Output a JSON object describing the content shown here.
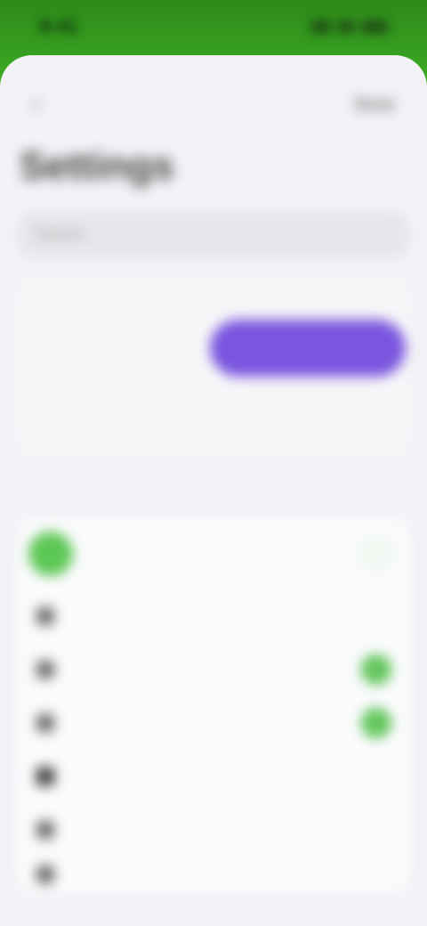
{
  "status_bar": {
    "time": "9:41"
  },
  "nav": {
    "back_glyph": "‹",
    "done_label": "Done"
  },
  "page": {
    "title": "Settings",
    "search_placeholder": "Search"
  },
  "mode_card": {
    "caption": "",
    "left_option": "",
    "right_option": "",
    "description": ""
  },
  "section": {
    "header": ""
  },
  "rows": [
    {
      "label": "",
      "icon": "app-icon",
      "check": "ring"
    },
    {
      "label": "",
      "icon": "dot-icon",
      "check": "off"
    },
    {
      "label": "",
      "icon": "dot-icon",
      "check": "on"
    },
    {
      "label": "",
      "icon": "dot-icon",
      "check": "on"
    },
    {
      "label": "",
      "icon": "dot-icon",
      "check": "off"
    },
    {
      "label": "",
      "icon": "dot-icon",
      "check": "off"
    },
    {
      "label": "",
      "icon": "dot-icon",
      "check": "off"
    }
  ],
  "colors": {
    "accent_purple": "#7a55e0",
    "toggle_green": "#57c24f",
    "wallpaper_green": "#3aa623"
  }
}
